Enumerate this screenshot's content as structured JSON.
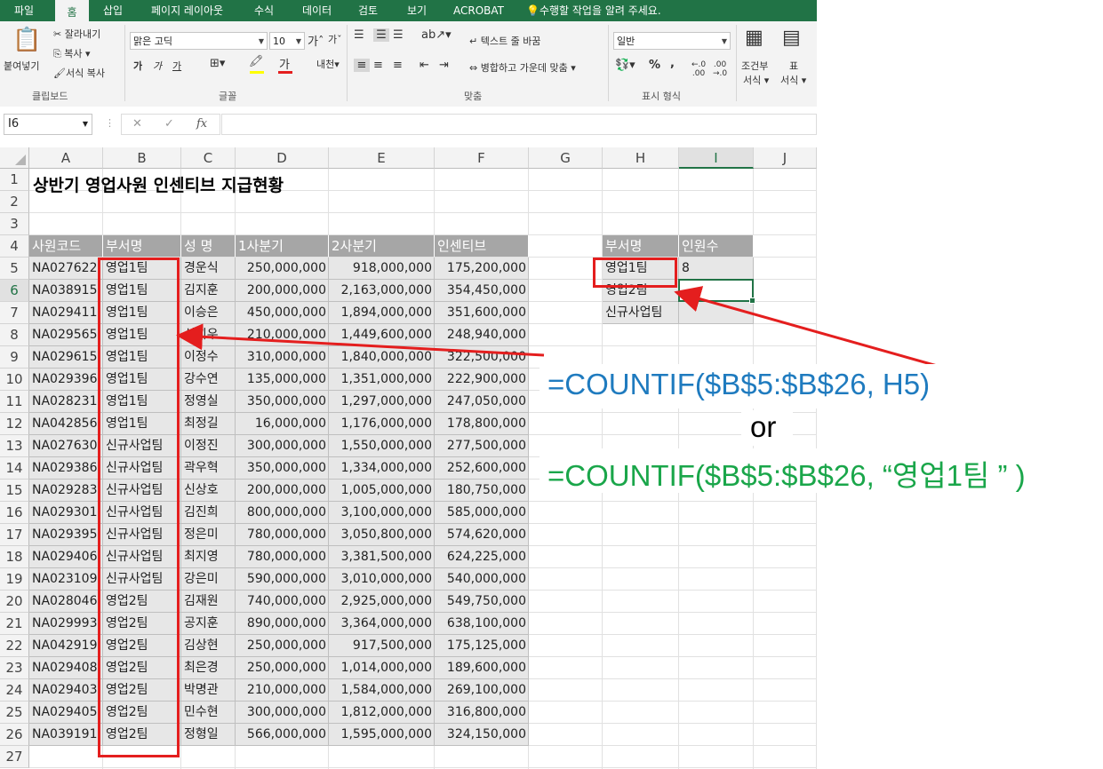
{
  "ribbon_tabs": [
    "파일",
    "홈",
    "삽입",
    "페이지 레이아웃",
    "수식",
    "데이터",
    "검토",
    "보기",
    "ACROBAT",
    "수행할 작업을 알려 주세요."
  ],
  "ribbon": {
    "clipboard": {
      "paste": "붙여넣기",
      "cut": "잘라내기",
      "copy": "복사",
      "format_painter": "서식 복사",
      "group": "클립보드"
    },
    "font": {
      "name": "맑은 고딕",
      "size": "10",
      "bold": "가",
      "italic": "가",
      "underline": "가",
      "group": "글꼴"
    },
    "alignment": {
      "wrap": "텍스트 줄 바꿈",
      "merge": "병합하고 가운데 맞춤",
      "group": "맞춤"
    },
    "number": {
      "format": "일반",
      "percent": "%",
      "comma": ",",
      "group": "표시 형식"
    },
    "styles": {
      "conditional": "조건부",
      "conditional2": "서식",
      "table": "표",
      "table2": "서식"
    }
  },
  "formula_bar": {
    "name_box": "I6",
    "cancel": "✕",
    "enter": "✓",
    "fx": "fx",
    "formula": ""
  },
  "columns": [
    "A",
    "B",
    "C",
    "D",
    "E",
    "F",
    "G",
    "H",
    "I",
    "J"
  ],
  "rows": [
    "1",
    "2",
    "3",
    "4",
    "5",
    "6",
    "7",
    "8",
    "9",
    "10",
    "11",
    "12",
    "13",
    "14",
    "15",
    "16",
    "17",
    "18",
    "19",
    "20",
    "21",
    "22",
    "23",
    "24",
    "25",
    "26",
    "27"
  ],
  "sheet": {
    "title": "상반기 영업사원 인센티브 지급현황",
    "headers": [
      "사원코드",
      "부서명",
      "성  명",
      "1사분기",
      "2사분기",
      "인센티브"
    ],
    "records": [
      [
        "NA027622",
        "영업1팀",
        "경운식",
        "250,000,000",
        "918,000,000",
        "175,200,000"
      ],
      [
        "NA038915",
        "영업1팀",
        "김지훈",
        "200,000,000",
        "2,163,000,000",
        "354,450,000"
      ],
      [
        "NA029411",
        "영업1팀",
        "이승은",
        "450,000,000",
        "1,894,000,000",
        "351,600,000"
      ],
      [
        "NA029565",
        "영업1팀",
        "신희우",
        "210,000,000",
        "1,449,600,000",
        "248,940,000"
      ],
      [
        "NA029615",
        "영업1팀",
        "이정수",
        "310,000,000",
        "1,840,000,000",
        "322,500,000"
      ],
      [
        "NA029396",
        "영업1팀",
        "강수연",
        "135,000,000",
        "1,351,000,000",
        "222,900,000"
      ],
      [
        "NA028231",
        "영업1팀",
        "정영실",
        "350,000,000",
        "1,297,000,000",
        "247,050,000"
      ],
      [
        "NA042856",
        "영업1팀",
        "최정길",
        "16,000,000",
        "1,176,000,000",
        "178,800,000"
      ],
      [
        "NA027630",
        "신규사업팀",
        "이정진",
        "300,000,000",
        "1,550,000,000",
        "277,500,000"
      ],
      [
        "NA029386",
        "신규사업팀",
        "곽우혁",
        "350,000,000",
        "1,334,000,000",
        "252,600,000"
      ],
      [
        "NA029283",
        "신규사업팀",
        "신상호",
        "200,000,000",
        "1,005,000,000",
        "180,750,000"
      ],
      [
        "NA029301",
        "신규사업팀",
        "김진희",
        "800,000,000",
        "3,100,000,000",
        "585,000,000"
      ],
      [
        "NA029395",
        "신규사업팀",
        "정은미",
        "780,000,000",
        "3,050,800,000",
        "574,620,000"
      ],
      [
        "NA029406",
        "신규사업팀",
        "최지영",
        "780,000,000",
        "3,381,500,000",
        "624,225,000"
      ],
      [
        "NA023109",
        "신규사업팀",
        "강은미",
        "590,000,000",
        "3,010,000,000",
        "540,000,000"
      ],
      [
        "NA028046",
        "영업2팀",
        "김재원",
        "740,000,000",
        "2,925,000,000",
        "549,750,000"
      ],
      [
        "NA029993",
        "영업2팀",
        "공지훈",
        "890,000,000",
        "3,364,000,000",
        "638,100,000"
      ],
      [
        "NA042919",
        "영업2팀",
        "김상현",
        "250,000,000",
        "917,500,000",
        "175,125,000"
      ],
      [
        "NA029408",
        "영업2팀",
        "최은경",
        "250,000,000",
        "1,014,000,000",
        "189,600,000"
      ],
      [
        "NA029403",
        "영업2팀",
        "박명관",
        "210,000,000",
        "1,584,000,000",
        "269,100,000"
      ],
      [
        "NA029405",
        "영업2팀",
        "민수현",
        "300,000,000",
        "1,812,000,000",
        "316,800,000"
      ],
      [
        "NA039191",
        "영업2팀",
        "정형일",
        "566,000,000",
        "1,595,000,000",
        "324,150,000"
      ]
    ],
    "summary_headers": [
      "부서명",
      "인원수"
    ],
    "summary": [
      [
        "영업1팀",
        "8"
      ],
      [
        "영업2팀",
        ""
      ],
      [
        "신규사업팀",
        ""
      ]
    ]
  },
  "annotations": {
    "formula1": "=COUNTIF($B$5:$B$26, H5)",
    "or": "or",
    "formula2": "=COUNTIF($B$5:$B$26, “영업1팀 ” )",
    "colors": {
      "red": "#e41e1e",
      "blue": "#1f7bbf",
      "green": "#1aa64a"
    }
  }
}
